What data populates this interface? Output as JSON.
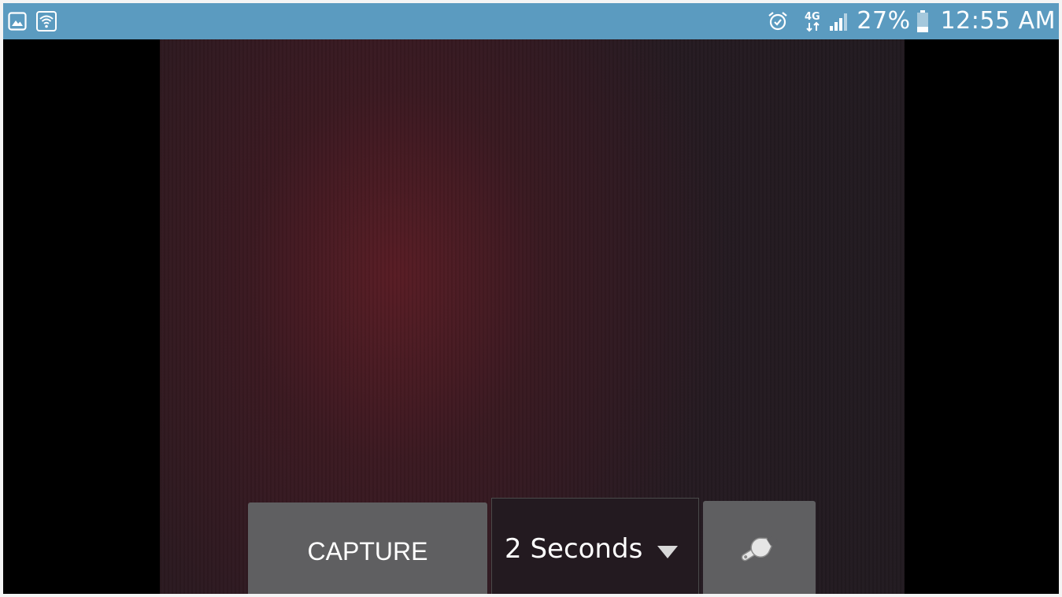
{
  "status_bar": {
    "left_icons": [
      "gallery-icon",
      "wifi-icon"
    ],
    "right_icons": [
      "alarm-icon",
      "network-4g-icon",
      "signal-icon",
      "battery-icon"
    ],
    "network_type": "4G",
    "battery_percent": "27%",
    "battery_level": 0.27,
    "time": "12:55 AM",
    "background_color": "#5b9bc0"
  },
  "camera": {
    "capture_label": "CAPTURE",
    "timer_value": "2 Seconds",
    "settings_icon": "wrench-icon"
  }
}
